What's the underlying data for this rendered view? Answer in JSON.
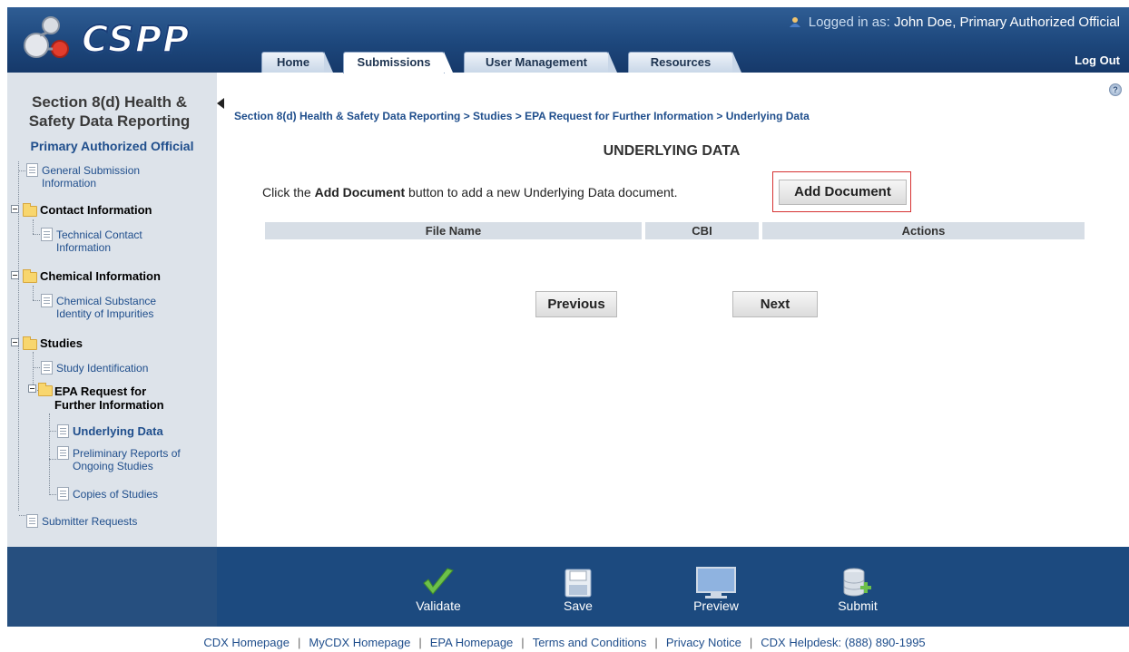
{
  "header": {
    "logo_text": "CSPP",
    "logged_in_prefix": "Logged in as:",
    "logged_in_user": "John Doe, Primary Authorized Official",
    "logout": "Log Out",
    "tabs": [
      {
        "label": "Home"
      },
      {
        "label": "Submissions",
        "active": true
      },
      {
        "label": "User Management"
      },
      {
        "label": "Resources"
      }
    ]
  },
  "sidebar": {
    "title": "Section 8(d) Health & Safety Data Reporting",
    "role": "Primary Authorized Official",
    "items": [
      {
        "label": "General Submission Information",
        "type": "doc"
      },
      {
        "label": "Contact Information",
        "type": "folder"
      },
      {
        "label": "Technical Contact Information",
        "type": "doc"
      },
      {
        "label": "Chemical Information",
        "type": "folder"
      },
      {
        "label": "Chemical Substance Identity of Impurities",
        "type": "doc"
      },
      {
        "label": "Studies",
        "type": "folder"
      },
      {
        "label": "Study Identification",
        "type": "doc"
      },
      {
        "label": "EPA Request for Further Information",
        "type": "folder"
      },
      {
        "label": "Underlying Data",
        "type": "doc",
        "current": true
      },
      {
        "label": "Preliminary Reports of Ongoing Studies",
        "type": "doc"
      },
      {
        "label": "Copies of Studies",
        "type": "doc"
      },
      {
        "label": "Submitter Requests",
        "type": "doc"
      }
    ]
  },
  "main": {
    "breadcrumb": "Section 8(d) Health & Safety Data Reporting > Studies > EPA Request for Further Information > Underlying Data",
    "title": "UNDERLYING DATA",
    "instruction_pre": "Click the",
    "instruction_bold": "Add Document",
    "instruction_post": "button to add a new Underlying Data document.",
    "add_button": "Add Document",
    "table_headers": [
      "File Name",
      "CBI",
      "Actions"
    ],
    "previous": "Previous",
    "next": "Next"
  },
  "toolbar": {
    "validate": "Validate",
    "save": "Save",
    "preview": "Preview",
    "submit": "Submit"
  },
  "footer_links": [
    "CDX Homepage",
    "MyCDX Homepage",
    "EPA Homepage",
    "Terms and Conditions",
    "Privacy Notice",
    "CDX Helpdesk: (888) 890-1995"
  ],
  "colors": {
    "header_blue": "#1d477c",
    "link_blue": "#1f4e8c",
    "sidebar_bg": "#dde3ea",
    "highlight_red": "#d63232",
    "validate_green": "#6cc04a"
  }
}
